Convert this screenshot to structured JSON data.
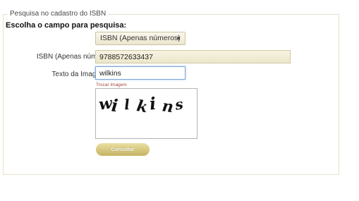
{
  "form": {
    "legend": "Pesquisa no cadastro do ISBN",
    "heading": "Escolha o campo para pesquisa:",
    "field_select": {
      "selected": "ISBN (Apenas números)",
      "icon": "chevron-down-icon"
    },
    "isbn_field": {
      "label": "ISBN (Apenas números):",
      "value": "9788572633437"
    },
    "captcha_field": {
      "label": "Texto da Imagem:",
      "value": "wilkins"
    },
    "change_image_link": "Trocar Imagem",
    "captcha_image": {
      "text": "wilkins"
    },
    "submit_label": "Consultar"
  }
}
